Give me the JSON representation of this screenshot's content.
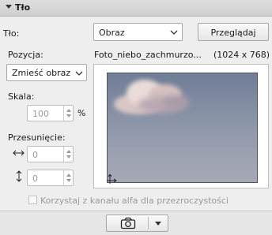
{
  "panel": {
    "title": "Tło"
  },
  "background": {
    "label": "Tło:",
    "type_value": "Obraz",
    "browse_label": "Przeglądaj"
  },
  "position": {
    "label": "Pozycja:",
    "value": "Zmieść obraz"
  },
  "file": {
    "name": "Foto_niebo_zachmurzo...",
    "dimensions": "(1024 x 768)"
  },
  "scale": {
    "label": "Skala:",
    "value": "100",
    "unit": "%"
  },
  "offset": {
    "label": "Przesunięcie:",
    "x_value": "0",
    "y_value": "0"
  },
  "alpha": {
    "label": "Korzystaj z kanału alfa dla przezroczystości",
    "checked": false
  },
  "icons": {
    "collapse": "triangle-down-icon",
    "horizontal": "horizontal-arrows-icon",
    "vertical": "vertical-arrows-icon",
    "camera": "camera-icon",
    "dropdown": "chevron-down-icon"
  }
}
